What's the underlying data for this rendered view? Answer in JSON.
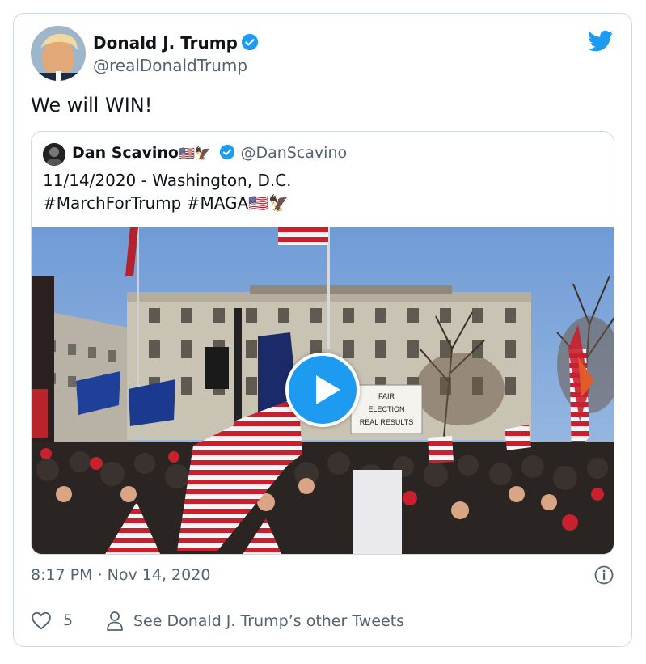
{
  "tweet": {
    "author_name": "Donald J. Trump",
    "author_handle": "@realDonaldTrump",
    "text": "We will WIN!",
    "timestamp": "8:17 PM · Nov 14, 2020",
    "like_count": "5",
    "other_tweets_label": "See Donald J. Trump’s other Tweets"
  },
  "quoted_tweet": {
    "author_name": "Dan Scavino",
    "author_emoji": "🇺🇸🦅",
    "author_handle": "@DanScavino",
    "text_line1": "11/14/2020 - Washington, D.C.",
    "text_line2": "#MarchForTrump #MAGA🇺🇸🦅",
    "media_sign_text": "FAIR ELECTION REAL RESULTS"
  },
  "colors": {
    "twitter_blue": "#1d9bf0",
    "text_primary": "#0f1419",
    "text_secondary": "#536471",
    "border": "#cfd9de"
  },
  "icons": [
    "verified-badge-icon",
    "twitter-bird-icon",
    "play-icon",
    "info-icon",
    "heart-icon",
    "person-icon"
  ]
}
